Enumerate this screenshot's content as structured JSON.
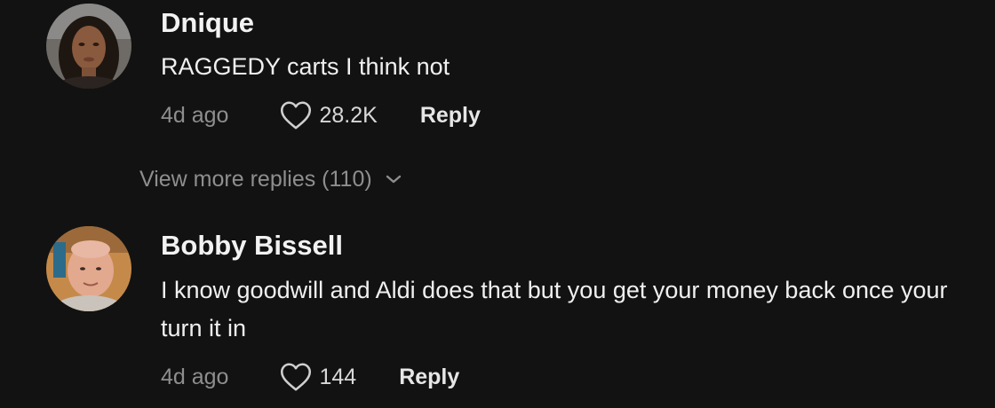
{
  "comments": [
    {
      "username": "Dnique",
      "text": "RAGGEDY carts I think not",
      "time": "4d ago",
      "likes": "28.2K",
      "reply_label": "Reply",
      "avatar": "woman-portrait"
    },
    {
      "username": "Bobby Bissell",
      "text": "I know goodwill and Aldi does that but you get your money back once your turn it in",
      "time": "4d ago",
      "likes": "144",
      "reply_label": "Reply",
      "avatar": "man-portrait"
    }
  ],
  "view_more": {
    "label": "View more replies (110)",
    "icon": "chevron-down-icon"
  },
  "colors": {
    "background": "#121212",
    "muted": "#8e8e8e",
    "text": "#f0f0f0"
  }
}
